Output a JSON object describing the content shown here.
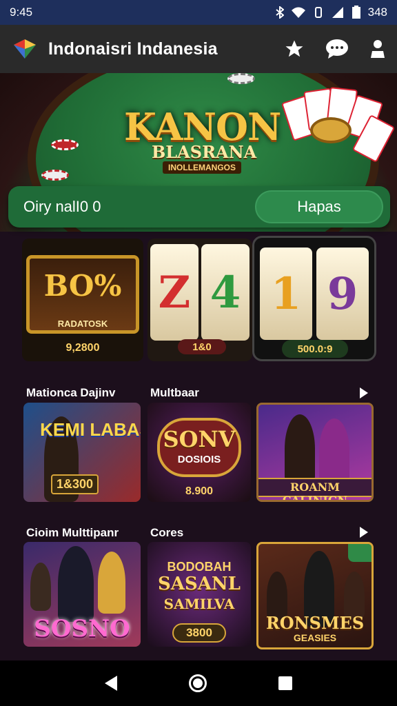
{
  "status_bar": {
    "time": "9:45",
    "battery": "348"
  },
  "app_bar": {
    "title": "Indonaisri Indanesia"
  },
  "hero": {
    "title": "KANON",
    "subtitle": "BLASRANA",
    "tagline": "INOLLEMANGOS"
  },
  "search": {
    "value": "Oiry nalI0 0",
    "button_label": "Hapas"
  },
  "featured_slots": [
    {
      "title": "BO%",
      "subtitle": "RADATOSK",
      "amount": "9,2800"
    },
    {
      "reel1": "Z",
      "reel2": "4",
      "amount": "1&0"
    },
    {
      "reel1": "1",
      "reel2": "9",
      "amount": "500.0:9"
    }
  ],
  "section1": {
    "titles": [
      "Mationca Dajinv",
      "Multbaar"
    ],
    "games": [
      {
        "title": "KEMI LABAS",
        "amount": "1&300"
      },
      {
        "title": "SONV",
        "subtitle": "DOSIOIS",
        "amount": "8.900"
      },
      {
        "title": "ROANM CALINIGN"
      }
    ]
  },
  "section2": {
    "titles": [
      "Cioim Multtipanr",
      "Cores"
    ],
    "games": [
      {
        "title": "SOSNO"
      },
      {
        "title": "BODOBAH",
        "subtitle": "SASANL",
        "subtitle2": "SAMILVA",
        "amount": "3800"
      },
      {
        "title": "RONSMES",
        "subtitle": "GEASIES"
      }
    ]
  },
  "colors": {
    "status_bar": "#1e2f5c",
    "app_bar": "#2a2a2a",
    "search_bar": "#1f6b38",
    "gold": "#f6c445",
    "background": "#1c0f1c"
  }
}
